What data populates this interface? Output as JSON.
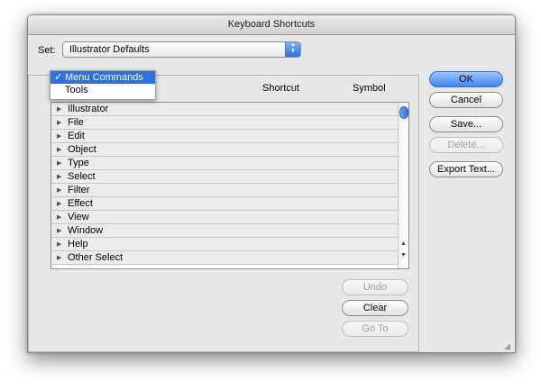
{
  "window": {
    "title": "Keyboard Shortcuts"
  },
  "set": {
    "label": "Set:",
    "value": "Illustrator Defaults"
  },
  "type_menu": {
    "options": [
      {
        "label": "Menu Commands",
        "checked": true
      },
      {
        "label": "Tools",
        "checked": false
      }
    ]
  },
  "columns": {
    "shortcut": "Shortcut",
    "symbol": "Symbol"
  },
  "list": {
    "items": [
      "Illustrator",
      "File",
      "Edit",
      "Object",
      "Type",
      "Select",
      "Filter",
      "Effect",
      "View",
      "Window",
      "Help",
      "Other Select"
    ]
  },
  "buttons": {
    "ok": "OK",
    "cancel": "Cancel",
    "save": "Save...",
    "delete": "Delete...",
    "export_text": "Export Text...",
    "undo": "Undo",
    "clear": "Clear",
    "go_to": "Go To"
  },
  "colors": {
    "accent": "#2f6fe0",
    "default_button": "#3f86f0"
  }
}
